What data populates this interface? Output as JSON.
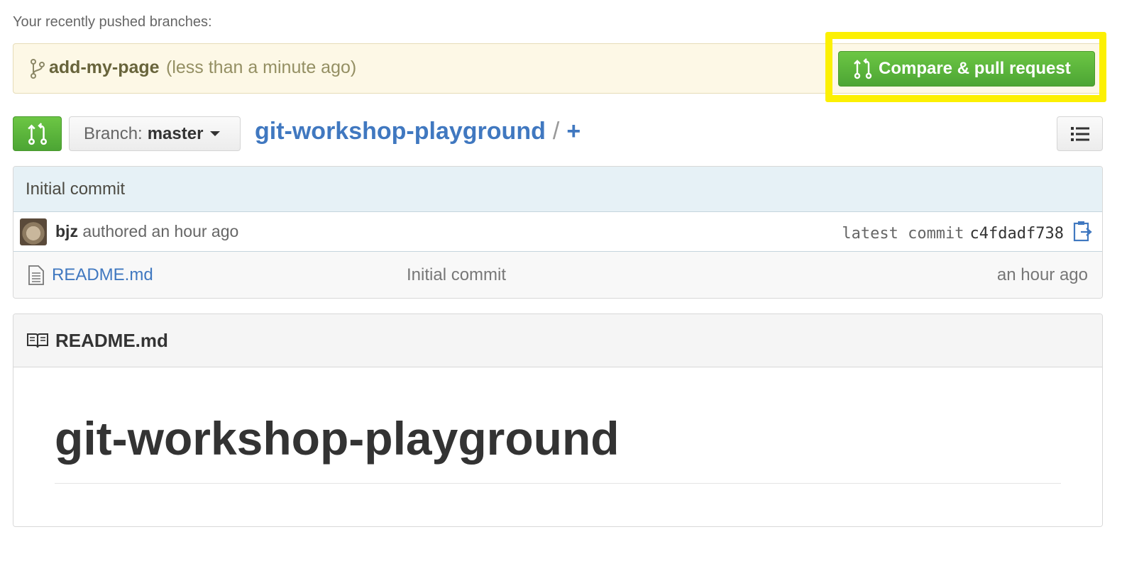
{
  "recent": {
    "label": "Your recently pushed branches:",
    "branch": "add-my-page",
    "time": "(less than a minute ago)",
    "compare_button": "Compare & pull request"
  },
  "toolbar": {
    "branch_prefix": "Branch:",
    "branch_name": "master",
    "repo_name": "git-workshop-playground",
    "path_sep": "/",
    "add_file": "+"
  },
  "commit": {
    "message": "Initial commit",
    "author": "bjz",
    "authored_text": "authored an hour ago",
    "latest_label": "latest commit",
    "sha": "c4fdadf738"
  },
  "files": [
    {
      "name": "README.md",
      "message": "Initial commit",
      "age": "an hour ago"
    }
  ],
  "readme": {
    "title": "README.md",
    "heading": "git-workshop-playground"
  },
  "colors": {
    "accent_green": "#6cc644",
    "link_blue": "#4078c0",
    "highlight_yellow": "#fcf003"
  }
}
